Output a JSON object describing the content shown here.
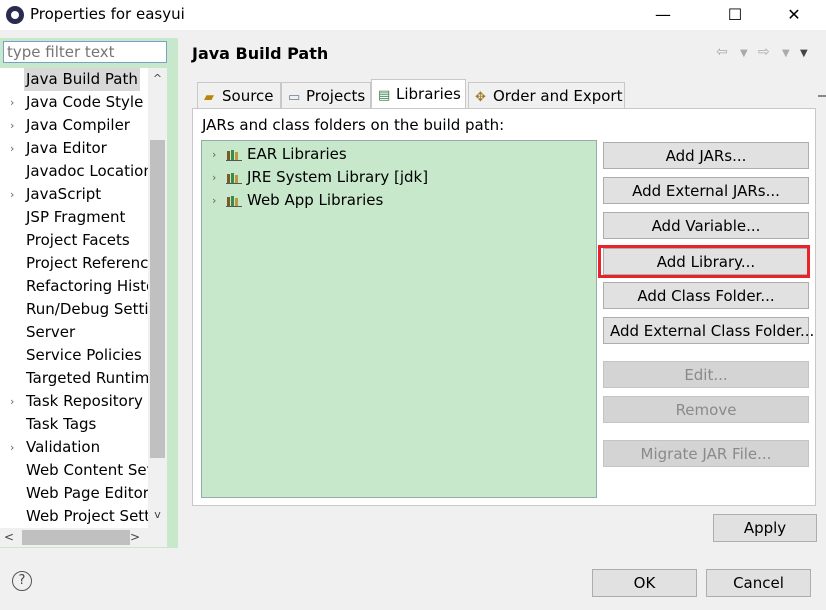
{
  "window": {
    "title": "Properties for easyui",
    "minimize": "—",
    "maximize": "☐",
    "close": "✕"
  },
  "sidebar": {
    "filter_placeholder": "type filter text",
    "items": [
      {
        "label": "Java Build Path",
        "arrow": "",
        "selected": true
      },
      {
        "label": "Java Code Style",
        "arrow": "›"
      },
      {
        "label": "Java Compiler",
        "arrow": "›"
      },
      {
        "label": "Java Editor",
        "arrow": "›"
      },
      {
        "label": "Javadoc Location",
        "arrow": ""
      },
      {
        "label": "JavaScript",
        "arrow": "›"
      },
      {
        "label": "JSP Fragment",
        "arrow": ""
      },
      {
        "label": "Project Facets",
        "arrow": ""
      },
      {
        "label": "Project References",
        "arrow": ""
      },
      {
        "label": "Refactoring History",
        "arrow": ""
      },
      {
        "label": "Run/Debug Settings",
        "arrow": ""
      },
      {
        "label": "Server",
        "arrow": ""
      },
      {
        "label": "Service Policies",
        "arrow": ""
      },
      {
        "label": "Targeted Runtimes",
        "arrow": ""
      },
      {
        "label": "Task Repository",
        "arrow": "›"
      },
      {
        "label": "Task Tags",
        "arrow": ""
      },
      {
        "label": "Validation",
        "arrow": "›"
      },
      {
        "label": "Web Content Settings",
        "arrow": ""
      },
      {
        "label": "Web Page Editor",
        "arrow": ""
      },
      {
        "label": "Web Project Settings",
        "arrow": ""
      }
    ]
  },
  "page": {
    "title": "Java Build Path",
    "tabs": [
      {
        "label": "Source",
        "icon": "source-folder-icon"
      },
      {
        "label": "Projects",
        "icon": "projects-icon"
      },
      {
        "label": "Libraries",
        "icon": "libraries-icon",
        "active": true
      },
      {
        "label": "Order and Export",
        "icon": "order-export-icon"
      }
    ],
    "description": "JARs and class folders on the build path:",
    "libraries": [
      {
        "label": "EAR Libraries"
      },
      {
        "label": "JRE System Library [jdk]"
      },
      {
        "label": "Web App Libraries"
      }
    ],
    "buttons": {
      "add_jars": "Add JARs...",
      "add_external_jars": "Add External JARs...",
      "add_variable": "Add Variable...",
      "add_library": "Add Library...",
      "add_class_folder": "Add Class Folder...",
      "add_external_class_folder": "Add External Class Folder...",
      "edit": "Edit...",
      "remove": "Remove",
      "migrate_jar": "Migrate JAR File..."
    },
    "apply": "Apply"
  },
  "footer": {
    "help": "?",
    "ok": "OK",
    "cancel": "Cancel"
  },
  "colors": {
    "highlight": "#e8242a",
    "tree_bg": "#c8e8cc"
  }
}
